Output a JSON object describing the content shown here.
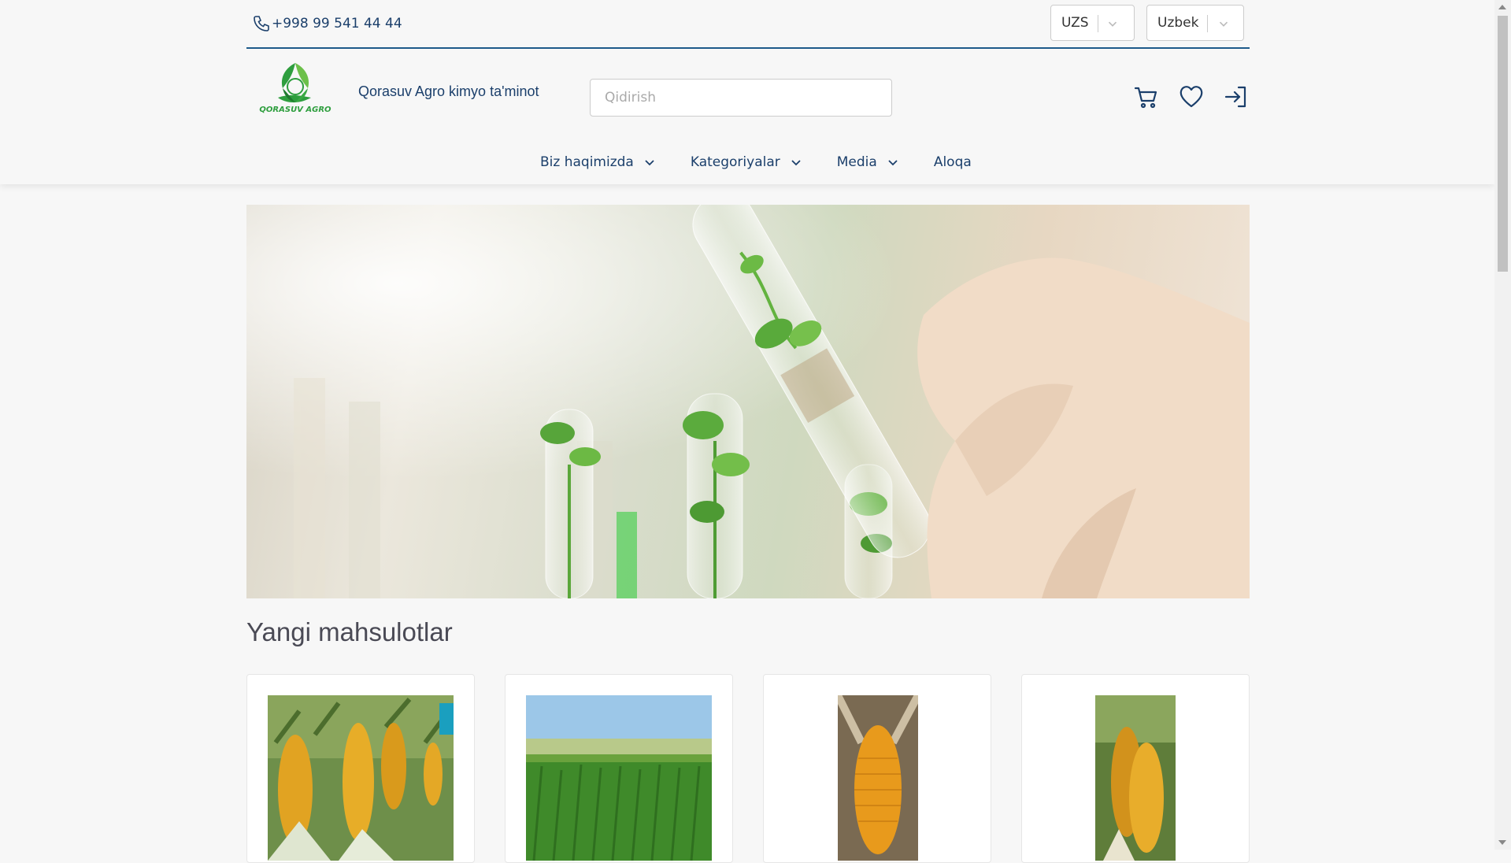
{
  "topbar": {
    "phone": "+998 99 541 44 44",
    "currency": "UZS",
    "language": "Uzbek"
  },
  "header": {
    "brand_name": "Qorasuv Agro kimyo ta'minot",
    "logo_text": "QORASUV AGRO",
    "search_placeholder": "Qidirish"
  },
  "nav": {
    "items": [
      {
        "label": "Biz haqimizda",
        "has_dropdown": true
      },
      {
        "label": "Kategoriyalar",
        "has_dropdown": true
      },
      {
        "label": "Media",
        "has_dropdown": true
      },
      {
        "label": "Aloqa",
        "has_dropdown": false
      }
    ]
  },
  "main": {
    "section_title": "Yangi mahsulotlar"
  },
  "colors": {
    "primary": "#1b3f6b",
    "accent_green": "#2e9e3e",
    "background": "#f7f7f7"
  },
  "icons": [
    "phone-icon",
    "chevron-down-icon",
    "cart-icon",
    "heart-icon",
    "login-icon"
  ]
}
